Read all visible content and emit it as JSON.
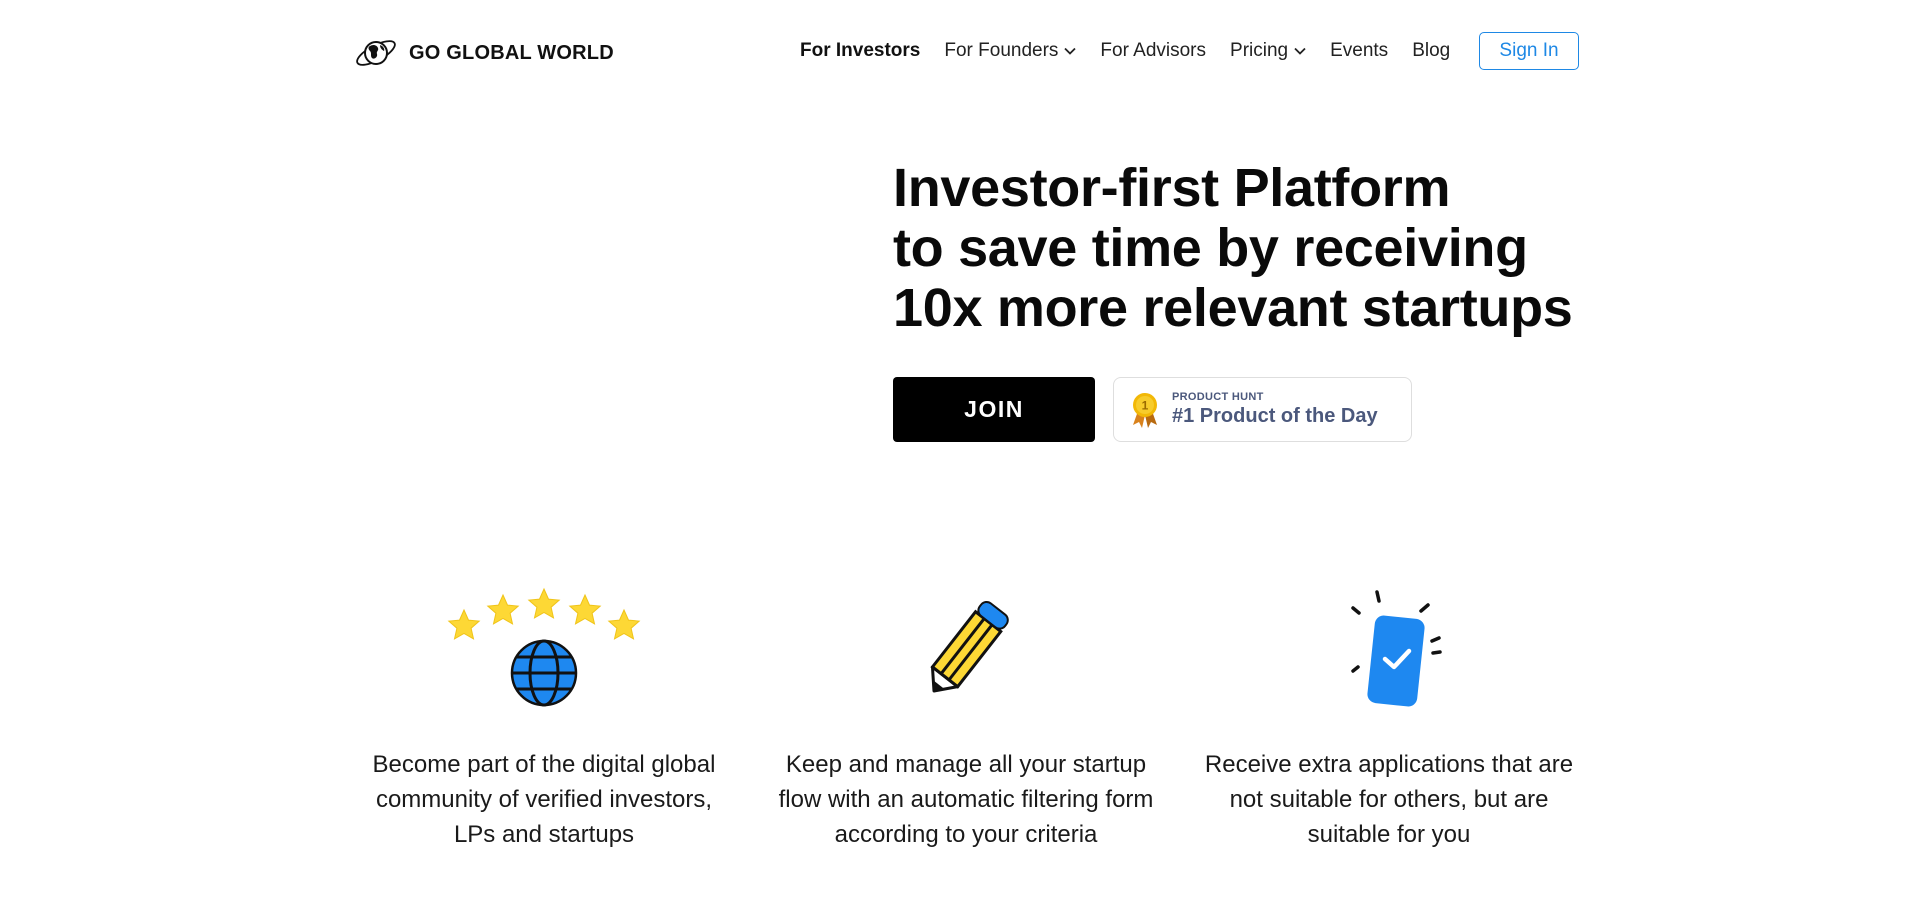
{
  "brand": {
    "name": "GO GLOBAL WORLD",
    "logo_icon": "planet-globe-icon"
  },
  "nav": {
    "items": [
      {
        "label": "For Investors",
        "active": true,
        "dropdown": false
      },
      {
        "label": "For Founders",
        "active": false,
        "dropdown": true
      },
      {
        "label": "For Advisors",
        "active": false,
        "dropdown": false
      },
      {
        "label": "Pricing",
        "active": false,
        "dropdown": true
      },
      {
        "label": "Events",
        "active": false,
        "dropdown": false
      },
      {
        "label": "Blog",
        "active": false,
        "dropdown": false
      }
    ],
    "signin_label": "Sign In"
  },
  "hero": {
    "title_lines": [
      "Investor-first Platform",
      "to save time by receiving",
      "10x more relevant startups"
    ],
    "join_label": "JOIN",
    "badge": {
      "icon": "medal-icon",
      "medal_number": "1",
      "label": "PRODUCT HUNT",
      "title": "#1 Product of the Day"
    }
  },
  "features": [
    {
      "icon": "stars-globe-icon",
      "text": "Become part of the digital global community of verified investors, LPs and startups"
    },
    {
      "icon": "pencil-icon",
      "text": "Keep and manage all your startup flow with an automatic filtering form according to your criteria"
    },
    {
      "icon": "phone-check-icon",
      "text": "Receive extra applications that are not suitable for others, but are suitable for you"
    }
  ],
  "colors": {
    "accent": "#1e88e5",
    "icon_blue": "#1e88f0",
    "star_yellow": "#fdd835",
    "badge_text": "#4b587c",
    "medal_gold": "#f2b807"
  }
}
